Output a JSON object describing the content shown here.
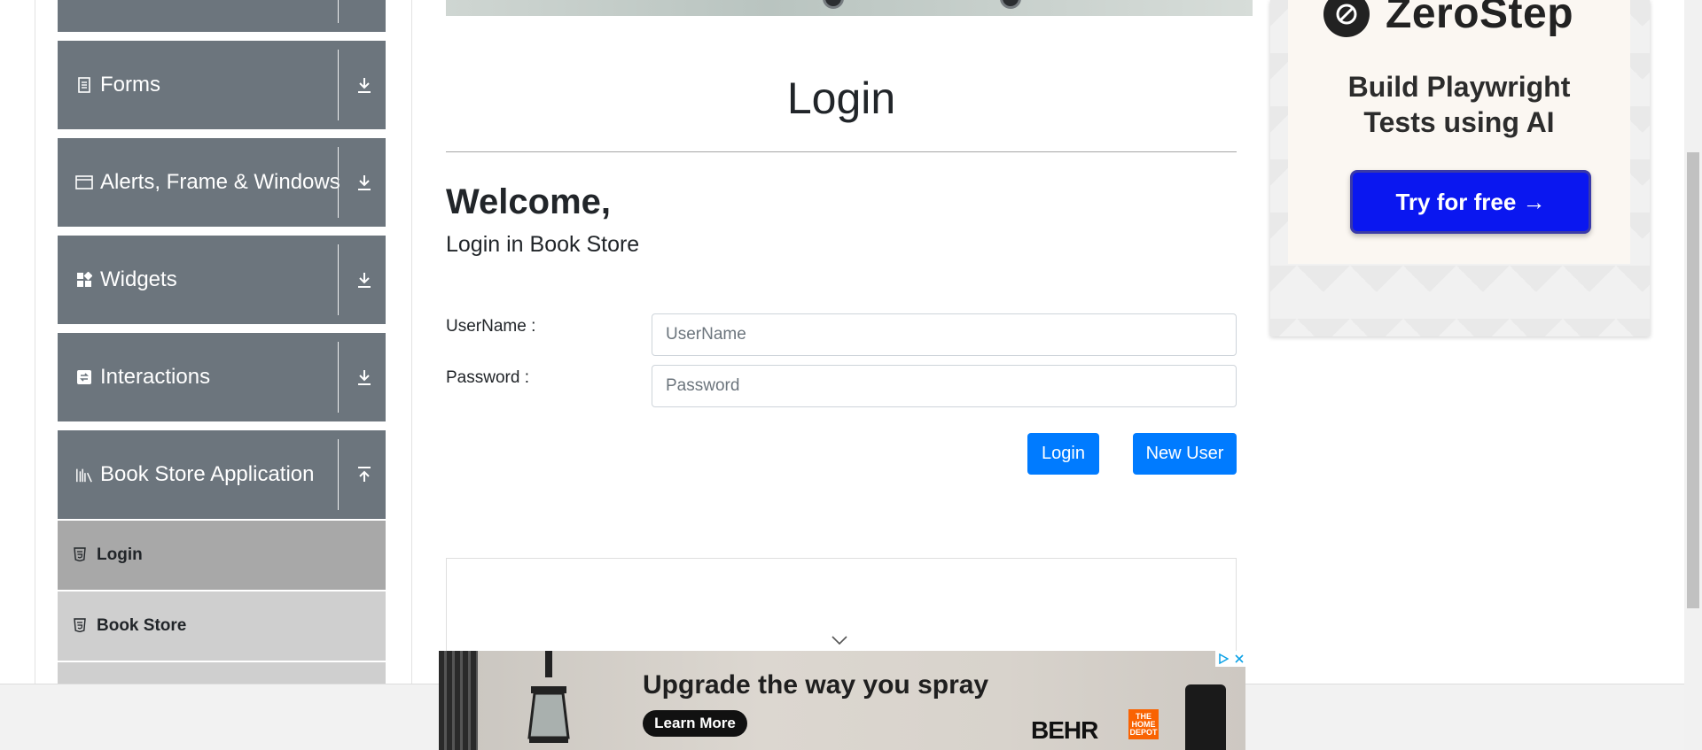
{
  "sidebar": {
    "groups": [
      {
        "label": "",
        "icon": "collapsed-group"
      },
      {
        "label": "Forms",
        "icon": "form-icon"
      },
      {
        "label": "Alerts, Frame & Windows",
        "icon": "window-icon"
      },
      {
        "label": "Widgets",
        "icon": "widgets-icon"
      },
      {
        "label": "Interactions",
        "icon": "interactions-icon"
      },
      {
        "label": "Book Store Application",
        "icon": "books-icon"
      }
    ],
    "items": [
      {
        "label": "Login",
        "state": "active"
      },
      {
        "label": "Book Store",
        "state": "normal"
      }
    ]
  },
  "main": {
    "title": "Login",
    "welcome": "Welcome,",
    "subheading": "Login in Book Store",
    "username_label": "UserName :",
    "username_placeholder": "UserName",
    "username_value": "",
    "password_label": "Password :",
    "password_placeholder": "Password",
    "password_value": "",
    "login_button": "Login",
    "new_user_button": "New User"
  },
  "ad_right": {
    "brand": "ZeroStep",
    "headline_line1": "Build Playwright",
    "headline_line2": "Tests using AI",
    "cta": "Try for free →",
    "cta_color": "#0a17f0"
  },
  "ad_bottom": {
    "headline": "Upgrade the way you spray",
    "cta": "Learn More",
    "brand": "BEHR",
    "retailer": "THE HOME DEPOT"
  },
  "colors": {
    "sidebar_group_bg": "#6c757d",
    "sidebar_active_bg": "#a8a8a8",
    "sidebar_item_bg": "#cfcfcf",
    "primary_button": "#007bff"
  }
}
